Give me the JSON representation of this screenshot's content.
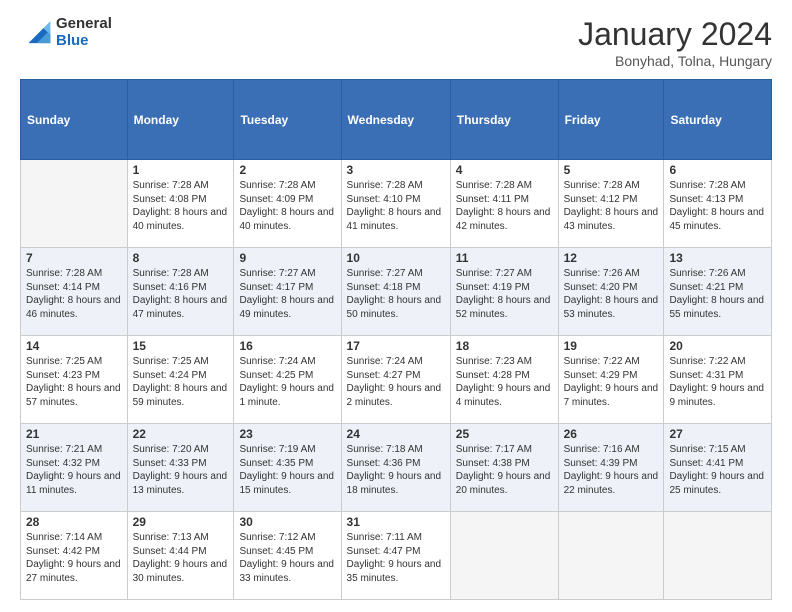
{
  "logo": {
    "general": "General",
    "blue": "Blue"
  },
  "header": {
    "title": "January 2024",
    "subtitle": "Bonyhad, Tolna, Hungary"
  },
  "days_of_week": [
    "Sunday",
    "Monday",
    "Tuesday",
    "Wednesday",
    "Thursday",
    "Friday",
    "Saturday"
  ],
  "weeks": [
    [
      {
        "day": "",
        "sunrise": "",
        "sunset": "",
        "daylight": ""
      },
      {
        "day": "1",
        "sunrise": "Sunrise: 7:28 AM",
        "sunset": "Sunset: 4:08 PM",
        "daylight": "Daylight: 8 hours and 40 minutes."
      },
      {
        "day": "2",
        "sunrise": "Sunrise: 7:28 AM",
        "sunset": "Sunset: 4:09 PM",
        "daylight": "Daylight: 8 hours and 40 minutes."
      },
      {
        "day": "3",
        "sunrise": "Sunrise: 7:28 AM",
        "sunset": "Sunset: 4:10 PM",
        "daylight": "Daylight: 8 hours and 41 minutes."
      },
      {
        "day": "4",
        "sunrise": "Sunrise: 7:28 AM",
        "sunset": "Sunset: 4:11 PM",
        "daylight": "Daylight: 8 hours and 42 minutes."
      },
      {
        "day": "5",
        "sunrise": "Sunrise: 7:28 AM",
        "sunset": "Sunset: 4:12 PM",
        "daylight": "Daylight: 8 hours and 43 minutes."
      },
      {
        "day": "6",
        "sunrise": "Sunrise: 7:28 AM",
        "sunset": "Sunset: 4:13 PM",
        "daylight": "Daylight: 8 hours and 45 minutes."
      }
    ],
    [
      {
        "day": "7",
        "sunrise": "Sunrise: 7:28 AM",
        "sunset": "Sunset: 4:14 PM",
        "daylight": "Daylight: 8 hours and 46 minutes."
      },
      {
        "day": "8",
        "sunrise": "Sunrise: 7:28 AM",
        "sunset": "Sunset: 4:16 PM",
        "daylight": "Daylight: 8 hours and 47 minutes."
      },
      {
        "day": "9",
        "sunrise": "Sunrise: 7:27 AM",
        "sunset": "Sunset: 4:17 PM",
        "daylight": "Daylight: 8 hours and 49 minutes."
      },
      {
        "day": "10",
        "sunrise": "Sunrise: 7:27 AM",
        "sunset": "Sunset: 4:18 PM",
        "daylight": "Daylight: 8 hours and 50 minutes."
      },
      {
        "day": "11",
        "sunrise": "Sunrise: 7:27 AM",
        "sunset": "Sunset: 4:19 PM",
        "daylight": "Daylight: 8 hours and 52 minutes."
      },
      {
        "day": "12",
        "sunrise": "Sunrise: 7:26 AM",
        "sunset": "Sunset: 4:20 PM",
        "daylight": "Daylight: 8 hours and 53 minutes."
      },
      {
        "day": "13",
        "sunrise": "Sunrise: 7:26 AM",
        "sunset": "Sunset: 4:21 PM",
        "daylight": "Daylight: 8 hours and 55 minutes."
      }
    ],
    [
      {
        "day": "14",
        "sunrise": "Sunrise: 7:25 AM",
        "sunset": "Sunset: 4:23 PM",
        "daylight": "Daylight: 8 hours and 57 minutes."
      },
      {
        "day": "15",
        "sunrise": "Sunrise: 7:25 AM",
        "sunset": "Sunset: 4:24 PM",
        "daylight": "Daylight: 8 hours and 59 minutes."
      },
      {
        "day": "16",
        "sunrise": "Sunrise: 7:24 AM",
        "sunset": "Sunset: 4:25 PM",
        "daylight": "Daylight: 9 hours and 1 minute."
      },
      {
        "day": "17",
        "sunrise": "Sunrise: 7:24 AM",
        "sunset": "Sunset: 4:27 PM",
        "daylight": "Daylight: 9 hours and 2 minutes."
      },
      {
        "day": "18",
        "sunrise": "Sunrise: 7:23 AM",
        "sunset": "Sunset: 4:28 PM",
        "daylight": "Daylight: 9 hours and 4 minutes."
      },
      {
        "day": "19",
        "sunrise": "Sunrise: 7:22 AM",
        "sunset": "Sunset: 4:29 PM",
        "daylight": "Daylight: 9 hours and 7 minutes."
      },
      {
        "day": "20",
        "sunrise": "Sunrise: 7:22 AM",
        "sunset": "Sunset: 4:31 PM",
        "daylight": "Daylight: 9 hours and 9 minutes."
      }
    ],
    [
      {
        "day": "21",
        "sunrise": "Sunrise: 7:21 AM",
        "sunset": "Sunset: 4:32 PM",
        "daylight": "Daylight: 9 hours and 11 minutes."
      },
      {
        "day": "22",
        "sunrise": "Sunrise: 7:20 AM",
        "sunset": "Sunset: 4:33 PM",
        "daylight": "Daylight: 9 hours and 13 minutes."
      },
      {
        "day": "23",
        "sunrise": "Sunrise: 7:19 AM",
        "sunset": "Sunset: 4:35 PM",
        "daylight": "Daylight: 9 hours and 15 minutes."
      },
      {
        "day": "24",
        "sunrise": "Sunrise: 7:18 AM",
        "sunset": "Sunset: 4:36 PM",
        "daylight": "Daylight: 9 hours and 18 minutes."
      },
      {
        "day": "25",
        "sunrise": "Sunrise: 7:17 AM",
        "sunset": "Sunset: 4:38 PM",
        "daylight": "Daylight: 9 hours and 20 minutes."
      },
      {
        "day": "26",
        "sunrise": "Sunrise: 7:16 AM",
        "sunset": "Sunset: 4:39 PM",
        "daylight": "Daylight: 9 hours and 22 minutes."
      },
      {
        "day": "27",
        "sunrise": "Sunrise: 7:15 AM",
        "sunset": "Sunset: 4:41 PM",
        "daylight": "Daylight: 9 hours and 25 minutes."
      }
    ],
    [
      {
        "day": "28",
        "sunrise": "Sunrise: 7:14 AM",
        "sunset": "Sunset: 4:42 PM",
        "daylight": "Daylight: 9 hours and 27 minutes."
      },
      {
        "day": "29",
        "sunrise": "Sunrise: 7:13 AM",
        "sunset": "Sunset: 4:44 PM",
        "daylight": "Daylight: 9 hours and 30 minutes."
      },
      {
        "day": "30",
        "sunrise": "Sunrise: 7:12 AM",
        "sunset": "Sunset: 4:45 PM",
        "daylight": "Daylight: 9 hours and 33 minutes."
      },
      {
        "day": "31",
        "sunrise": "Sunrise: 7:11 AM",
        "sunset": "Sunset: 4:47 PM",
        "daylight": "Daylight: 9 hours and 35 minutes."
      },
      {
        "day": "",
        "sunrise": "",
        "sunset": "",
        "daylight": ""
      },
      {
        "day": "",
        "sunrise": "",
        "sunset": "",
        "daylight": ""
      },
      {
        "day": "",
        "sunrise": "",
        "sunset": "",
        "daylight": ""
      }
    ]
  ]
}
